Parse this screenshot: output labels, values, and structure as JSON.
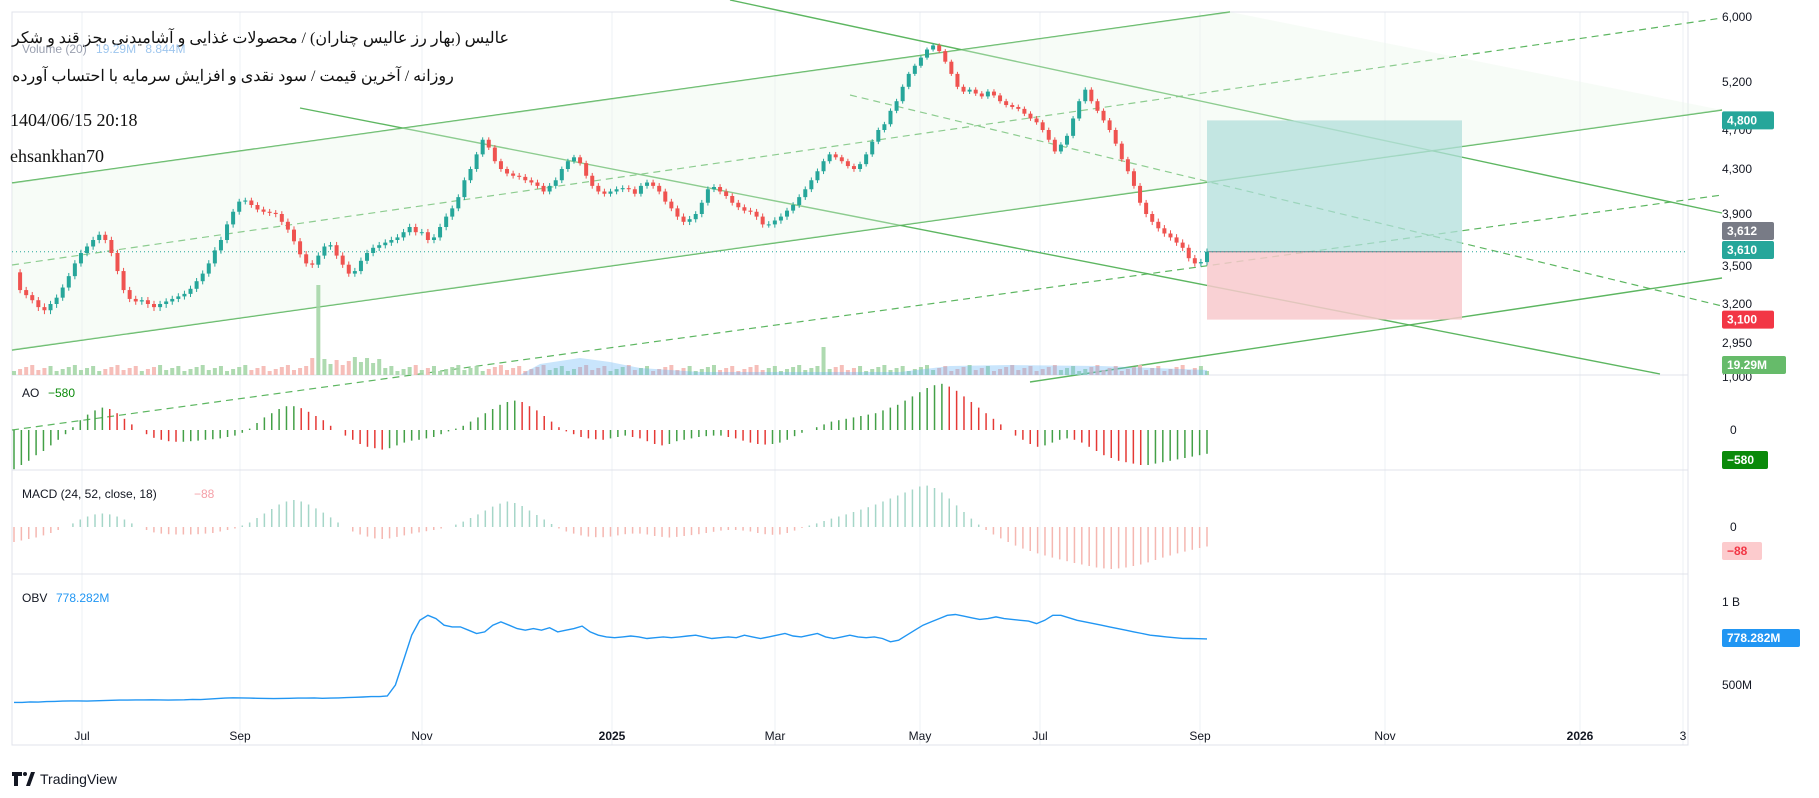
{
  "header": {
    "symbol_line": "عالیس (بهار رز عالیس چناران) / محصولات غذایی و آشامیدنی بجز قند و شکر",
    "subtitle_line": "روزانه / آخرین قیمت / سود نقدی و افزایش سرمایه با احتساب آورده",
    "timestamp": "1404/06/15 20:18",
    "author": "ehsankhan70",
    "volume_legend": "Volume (20)",
    "volume_value": "19.29M",
    "volume_value2": "8.844M"
  },
  "branding": {
    "name": "TradingView",
    "logo_icon": "tradingview-logo-icon"
  },
  "colors": {
    "up": "#26a69a",
    "down": "#ef5350",
    "channel": "#4caf50",
    "ao_up": "#43a047",
    "ao_down": "#e53935",
    "macd_up": "#a5d6c8",
    "macd_down": "#f5b7b1",
    "obv": "#2196f3",
    "target": "#b2dfdb",
    "stop": "#f8c9cc"
  },
  "chart_data": [
    {
      "type": "line",
      "name": "price",
      "series": [
        {
          "values": [
            3450,
            3310,
            3270,
            3230,
            3180,
            3160,
            3200,
            3250,
            3330,
            3420,
            3520,
            3600,
            3650,
            3700,
            3740,
            3700,
            3600,
            3460,
            3310,
            3240,
            3220,
            3230,
            3200,
            3180,
            3200,
            3220,
            3240,
            3260,
            3280,
            3320,
            3380,
            3440,
            3520,
            3620,
            3700,
            3820,
            3920,
            4010,
            4020,
            3980,
            3940,
            3920,
            3910,
            3900,
            3840,
            3780,
            3690,
            3590,
            3520,
            3510,
            3580,
            3650,
            3660,
            3580,
            3510,
            3440,
            3460,
            3540,
            3600,
            3640,
            3660,
            3680,
            3700,
            3720,
            3760,
            3800,
            3760,
            3760,
            3700,
            3720,
            3800,
            3880,
            3950,
            4050,
            4200,
            4300,
            4450,
            4600,
            4520,
            4380,
            4300,
            4260,
            4240,
            4230,
            4200,
            4180,
            4150,
            4100,
            4150,
            4200,
            4300,
            4380,
            4420,
            4360,
            4240,
            4150,
            4100,
            4080,
            4100,
            4120,
            4130,
            4120,
            4080,
            4150,
            4180,
            4150,
            4100,
            4010,
            3950,
            3880,
            3840,
            3860,
            3900,
            4000,
            4120,
            4140,
            4100,
            4060,
            4000,
            3960,
            3930,
            3920,
            3880,
            3820,
            3820,
            3850,
            3880,
            3930,
            3980,
            4050,
            4120,
            4200,
            4280,
            4380,
            4450,
            4420,
            4380,
            4330,
            4300,
            4350,
            4450,
            4580,
            4700,
            4760,
            4900,
            5000,
            5150,
            5300,
            5400,
            5500,
            5600,
            5650,
            5580,
            5450,
            5300,
            5150,
            5100,
            5120,
            5080,
            5050,
            5100,
            5060,
            5000,
            4960,
            4940,
            4920,
            4870,
            4820,
            4780,
            4700,
            4600,
            4480,
            4550,
            4640,
            4820,
            5000,
            5120,
            5000,
            4900,
            4800,
            4700,
            4560,
            4400,
            4280,
            4150,
            4000,
            3900,
            3840,
            3790,
            3750,
            3720,
            3680,
            3640,
            3560,
            3520,
            3530,
            3610
          ]
        }
      ],
      "x_ticks": [
        "Jul",
        "Sep",
        "Nov",
        "2025",
        "Mar",
        "May",
        "Jul",
        "Sep",
        "Nov",
        "2026",
        "3"
      ],
      "y_ticks": [
        "6,000",
        "5,200",
        "4,700",
        "4,300",
        "3,900",
        "3,500",
        "3,200",
        "2,950",
        "1,000"
      ],
      "price_labels": {
        "target": "4,800",
        "prev_close": "3,612",
        "last": "3,610",
        "stop": "3,100",
        "volume": "19.29M"
      },
      "position": {
        "entry": 3610,
        "target": 4800,
        "stop": 3100
      }
    },
    {
      "type": "bar",
      "name": "ao",
      "legend": "AO",
      "value_label": "−580",
      "y_ticks": [
        "0"
      ],
      "values": [
        -1.4,
        -1.25,
        -1.1,
        -0.9,
        -0.75,
        -0.55,
        -0.35,
        -0.15,
        0.1,
        0.35,
        0.55,
        0.7,
        0.8,
        0.75,
        0.6,
        0.4,
        0.2,
        0,
        -0.15,
        -0.28,
        -0.35,
        -0.4,
        -0.42,
        -0.42,
        -0.4,
        -0.38,
        -0.35,
        -0.33,
        -0.3,
        -0.25,
        -0.2,
        -0.1,
        0.05,
        0.25,
        0.45,
        0.6,
        0.75,
        0.85,
        0.85,
        0.78,
        0.65,
        0.5,
        0.35,
        0.15,
        0,
        -0.2,
        -0.35,
        -0.5,
        -0.6,
        -0.65,
        -0.7,
        -0.65,
        -0.55,
        -0.45,
        -0.38,
        -0.35,
        -0.3,
        -0.25,
        -0.15,
        -0.05,
        0.05,
        0.15,
        0.3,
        0.45,
        0.6,
        0.75,
        0.9,
        1,
        1.05,
        1,
        0.85,
        0.7,
        0.5,
        0.3,
        0.1,
        -0.05,
        -0.15,
        -0.25,
        -0.3,
        -0.33,
        -0.35,
        -0.3,
        -0.25,
        -0.2,
        -0.25,
        -0.3,
        -0.4,
        -0.5,
        -0.55,
        -0.5,
        -0.4,
        -0.35,
        -0.3,
        -0.25,
        -0.22,
        -0.2,
        -0.2,
        -0.25,
        -0.3,
        -0.38,
        -0.45,
        -0.5,
        -0.52,
        -0.5,
        -0.45,
        -0.35,
        -0.22,
        -0.1,
        0,
        0.1,
        0.2,
        0.3,
        0.35,
        0.4,
        0.45,
        0.5,
        0.55,
        0.6,
        0.7,
        0.8,
        0.9,
        1.05,
        1.2,
        1.35,
        1.5,
        1.6,
        1.65,
        1.55,
        1.4,
        1.2,
        1,
        0.8,
        0.6,
        0.4,
        0.2,
        0,
        -0.2,
        -0.35,
        -0.5,
        -0.6,
        -0.55,
        -0.45,
        -0.35,
        -0.3,
        -0.35,
        -0.45,
        -0.6,
        -0.75,
        -0.9,
        -1,
        -1.1,
        -1.15,
        -1.2,
        -1.25,
        -1.25,
        -1.2,
        -1.15,
        -1.1,
        -1.05,
        -1,
        -0.95,
        -0.9,
        -0.85
      ]
    },
    {
      "type": "bar",
      "name": "macd",
      "legend": "MACD (24, 52, close, 18)",
      "value_label": "−88",
      "y_ticks": [
        "0"
      ],
      "values": [
        -0.5,
        -0.45,
        -0.4,
        -0.35,
        -0.28,
        -0.2,
        -0.1,
        0,
        0.12,
        0.25,
        0.35,
        0.42,
        0.45,
        0.42,
        0.35,
        0.25,
        0.12,
        0,
        -0.1,
        -0.18,
        -0.22,
        -0.24,
        -0.25,
        -0.25,
        -0.25,
        -0.24,
        -0.22,
        -0.2,
        -0.15,
        -0.1,
        -0.05,
        0.05,
        0.15,
        0.3,
        0.45,
        0.6,
        0.75,
        0.85,
        0.9,
        0.85,
        0.75,
        0.62,
        0.48,
        0.32,
        0.15,
        0,
        -0.15,
        -0.25,
        -0.32,
        -0.38,
        -0.4,
        -0.38,
        -0.33,
        -0.28,
        -0.22,
        -0.18,
        -0.14,
        -0.1,
        -0.05,
        0,
        0.08,
        0.18,
        0.3,
        0.42,
        0.55,
        0.68,
        0.78,
        0.85,
        0.8,
        0.7,
        0.55,
        0.4,
        0.25,
        0.1,
        -0.05,
        -0.15,
        -0.22,
        -0.28,
        -0.32,
        -0.34,
        -0.34,
        -0.32,
        -0.28,
        -0.24,
        -0.22,
        -0.22,
        -0.25,
        -0.3,
        -0.33,
        -0.35,
        -0.33,
        -0.3,
        -0.27,
        -0.24,
        -0.2,
        -0.16,
        -0.12,
        -0.1,
        -0.1,
        -0.12,
        -0.15,
        -0.2,
        -0.24,
        -0.26,
        -0.25,
        -0.2,
        -0.12,
        -0.03,
        0.05,
        0.12,
        0.2,
        0.28,
        0.35,
        0.42,
        0.5,
        0.58,
        0.66,
        0.75,
        0.85,
        0.95,
        1.05,
        1.15,
        1.25,
        1.35,
        1.38,
        1.3,
        1.15,
        0.95,
        0.72,
        0.5,
        0.28,
        0.08,
        -0.1,
        -0.25,
        -0.38,
        -0.5,
        -0.62,
        -0.72,
        -0.8,
        -0.88,
        -0.95,
        -1.02,
        -1.08,
        -1.14,
        -1.2,
        -1.25,
        -1.3,
        -1.35,
        -1.38,
        -1.4,
        -1.38,
        -1.35,
        -1.3,
        -1.25,
        -1.18,
        -1.1,
        -1.02,
        -0.95,
        -0.88,
        -0.82,
        -0.76,
        -0.7,
        -0.65
      ]
    },
    {
      "type": "line",
      "name": "obv",
      "legend": "OBV",
      "value_label": "778.282M",
      "y_ticks": [
        "1 B",
        "500M"
      ],
      "values": [
        395,
        395,
        398,
        397,
        400,
        401,
        403,
        404,
        404,
        403,
        405,
        406,
        408,
        409,
        409,
        410,
        410,
        411,
        410,
        409,
        410,
        411,
        413,
        412,
        415,
        418,
        421,
        423,
        422,
        421,
        420,
        419,
        418,
        419,
        420,
        421,
        421,
        422,
        420,
        421,
        422,
        424,
        426,
        428,
        430,
        430,
        434,
        500,
        650,
        800,
        890,
        920,
        900,
        860,
        850,
        850,
        830,
        810,
        820,
        860,
        880,
        860,
        840,
        830,
        840,
        830,
        845,
        820,
        830,
        840,
        855,
        820,
        800,
        790,
        785,
        790,
        795,
        790,
        780,
        785,
        790,
        785,
        790,
        795,
        800,
        790,
        780,
        785,
        790,
        785,
        800,
        790,
        780,
        790,
        800,
        810,
        795,
        790,
        800,
        810,
        790,
        780,
        790,
        800,
        790,
        785,
        790,
        780,
        760,
        770,
        800,
        830,
        860,
        880,
        900,
        920,
        925,
        915,
        905,
        895,
        900,
        910,
        900,
        895,
        890,
        885,
        870,
        890,
        920,
        920,
        905,
        890,
        880,
        870,
        860,
        850,
        840,
        830,
        820,
        810,
        800,
        795,
        790,
        785,
        781,
        780,
        779,
        778
      ]
    }
  ]
}
